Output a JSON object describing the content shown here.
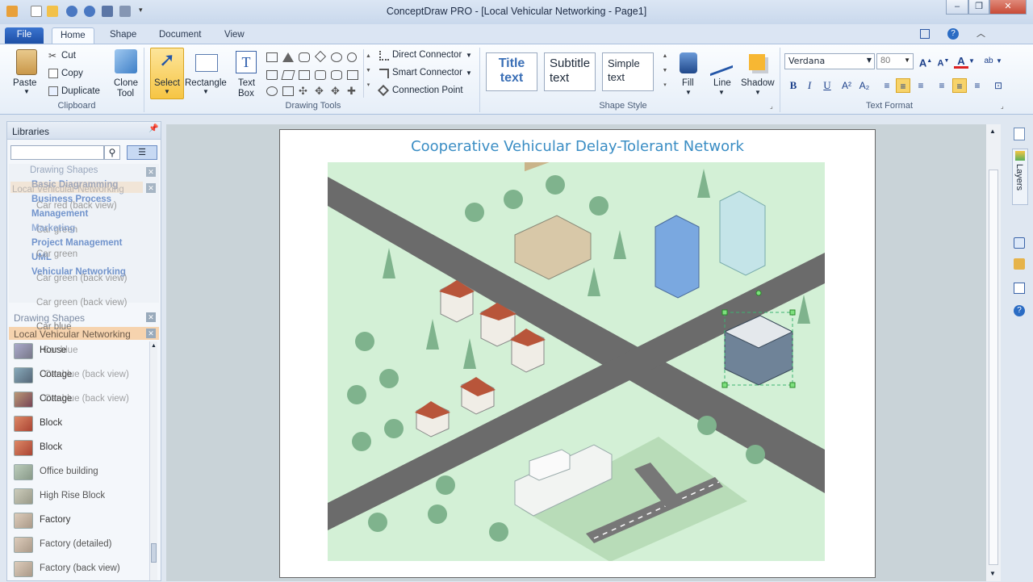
{
  "window": {
    "title": "ConceptDraw PRO - [Local Vehicular Networking - Page1]"
  },
  "tabs": {
    "file": "File",
    "home": "Home",
    "shape": "Shape",
    "document": "Document",
    "view": "View"
  },
  "clipboard": {
    "paste": "Paste",
    "cut": "Cut",
    "copy": "Copy",
    "duplicate": "Duplicate",
    "clone_tool_1": "Clone",
    "clone_tool_2": "Tool",
    "group": "Clipboard"
  },
  "drawing_tools": {
    "select": "Select",
    "rectangle": "Rectangle",
    "text_box_1": "Text",
    "text_box_2": "Box",
    "direct_connector": "Direct Connector",
    "smart_connector": "Smart Connector",
    "connection_point": "Connection Point",
    "group": "Drawing Tools"
  },
  "shape_style": {
    "title_1": "Title",
    "title_2": "text",
    "subtitle_1": "Subtitle",
    "subtitle_2": "text",
    "simple_1": "Simple",
    "simple_2": "text",
    "fill": "Fill",
    "line": "Line",
    "shadow": "Shadow",
    "group": "Shape Style"
  },
  "text_format": {
    "font": "Verdana",
    "size": "80",
    "group": "Text Format"
  },
  "libraries": {
    "title": "Libraries",
    "ghost_top": [
      "Drawing Shapes",
      "Basic Diagramming",
      "Local Vehicular Networking",
      "Business Process",
      "Car red (back view)",
      "Management",
      "Car green",
      "Marketing",
      "Project Management",
      "UML",
      "Car green",
      "Vehicular Networking",
      "Car green (back view)",
      "Car green (back view)"
    ],
    "panel2_headers": [
      "Drawing Shapes",
      "Local Vehicular Networking"
    ],
    "items": [
      {
        "label": "Car blue",
        "ghost": "House"
      },
      {
        "label": "Car blue (back view)",
        "ghost": "Cottage"
      },
      {
        "label": "Car blue (back view)",
        "ghost": "Cottage"
      },
      {
        "label": "Block",
        "ghost": "Block"
      },
      {
        "label": "Block",
        "ghost": "Block"
      },
      {
        "label": "Office building",
        "ghost": "Office building"
      },
      {
        "label": "High Rise Block",
        "ghost": "High Rise Block"
      },
      {
        "label": "Factory",
        "ghost": "Factory"
      },
      {
        "label": "Factory (detailed)",
        "ghost": "Factory (detailed)"
      },
      {
        "label": "Factory (back view)",
        "ghost": "Factory (detailed)"
      }
    ],
    "car_blue": "Car blue"
  },
  "diagram": {
    "title": "Cooperative Vehicular Delay-Tolerant Network"
  },
  "side": {
    "layers": "Layers"
  },
  "colors": {
    "ribbon_accent": "#f7d36a",
    "title_color": "#3a8dc4",
    "grass": "#d3f0d6",
    "road": "#6b6b6b"
  }
}
